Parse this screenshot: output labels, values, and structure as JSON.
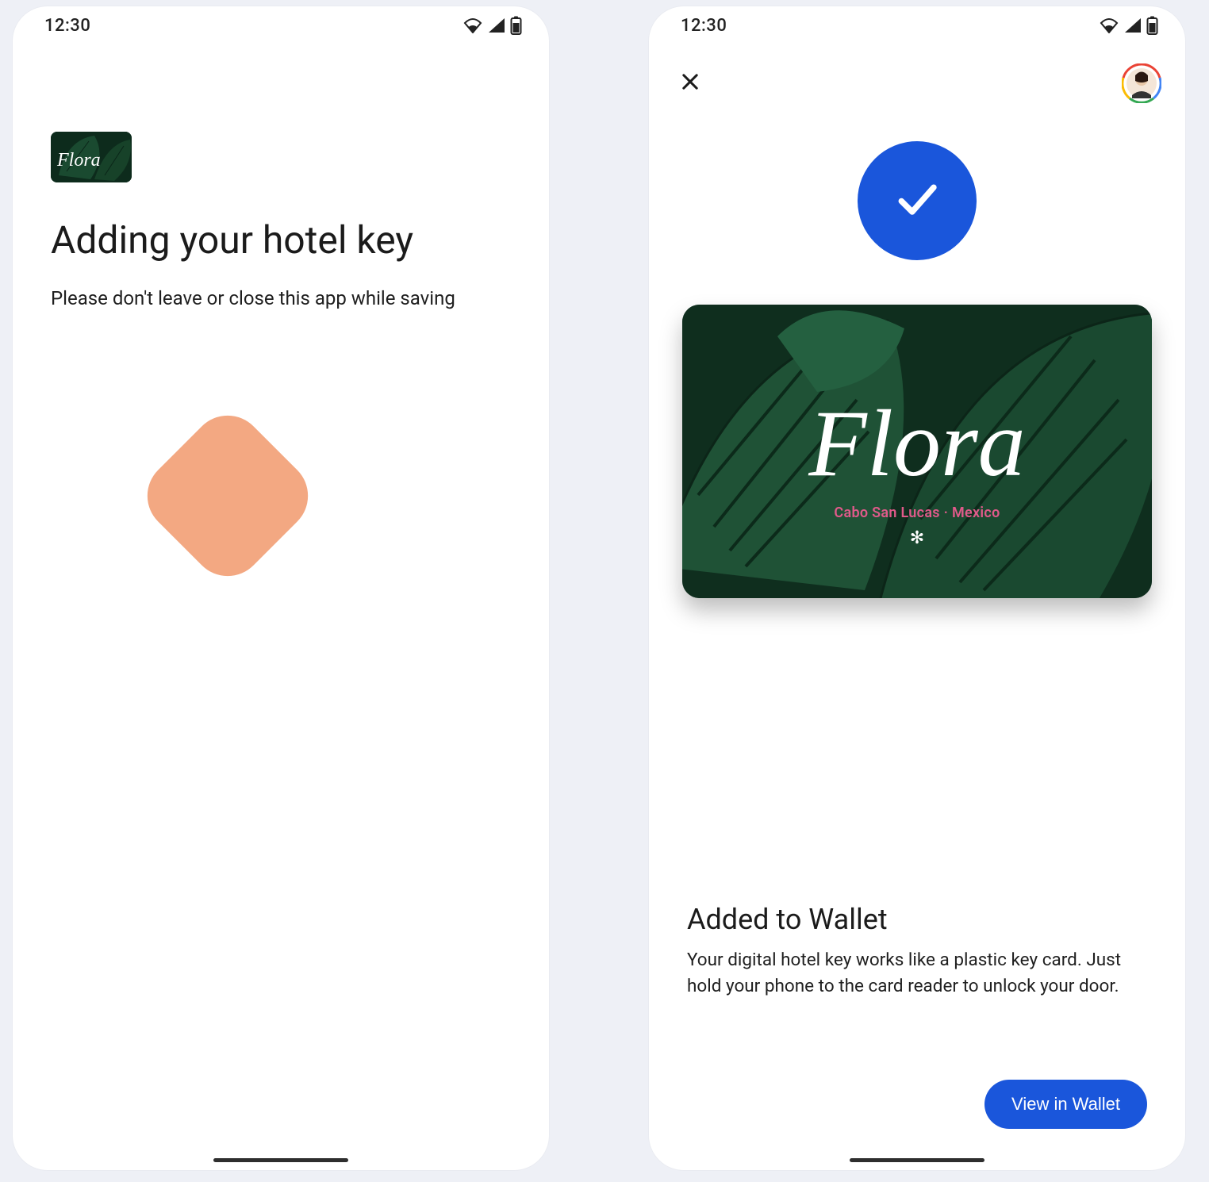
{
  "status": {
    "time": "12:30"
  },
  "left": {
    "brand": "Flora",
    "heading": "Adding your hotel key",
    "sub": "Please don't leave or close this app while saving"
  },
  "right": {
    "brand": "Flora",
    "location": "Cabo San Lucas · Mexico",
    "heading": "Added to Wallet",
    "sub": "Your digital hotel key works like a plastic key card. Just hold your phone to the card reader to unlock your door.",
    "button": "View in Wallet"
  },
  "colors": {
    "accent_blue": "#1a56db",
    "spinner_peach": "#f3a882",
    "card_green": "#123524",
    "location_pink": "#e05a8a"
  }
}
